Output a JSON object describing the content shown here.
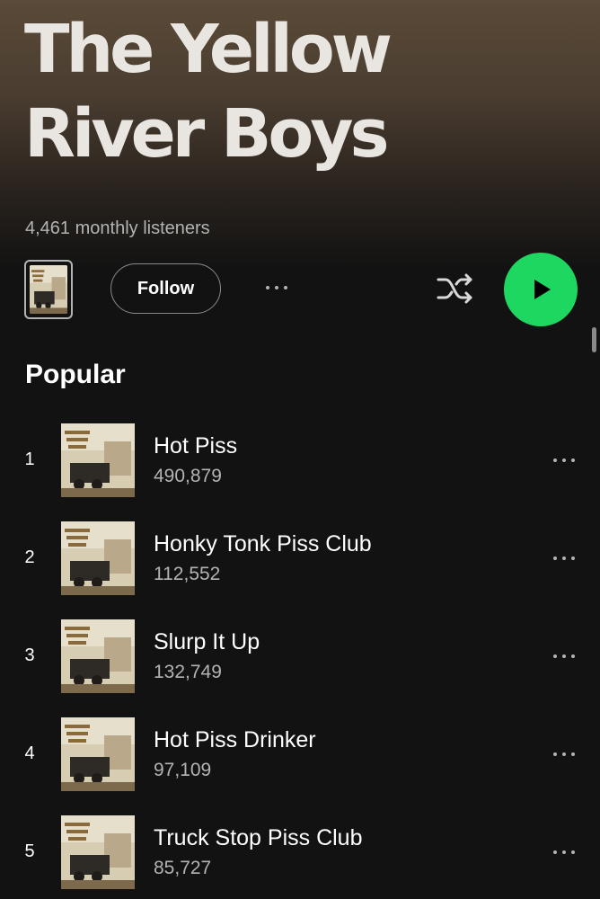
{
  "artist": {
    "name_line1": "The Yellow",
    "name_line2": "River Boys",
    "monthly_listeners": "4,461 monthly listeners"
  },
  "controls": {
    "follow_label": "Follow",
    "more_icon": "more-horizontal-icon",
    "shuffle_icon": "shuffle-icon",
    "play_icon": "play-icon"
  },
  "popular": {
    "title": "Popular",
    "tracks": [
      {
        "rank": "1",
        "title": "Hot Piss",
        "plays": "490,879"
      },
      {
        "rank": "2",
        "title": "Honky Tonk Piss Club",
        "plays": "112,552"
      },
      {
        "rank": "3",
        "title": "Slurp It Up",
        "plays": "132,749"
      },
      {
        "rank": "4",
        "title": "Hot Piss Drinker",
        "plays": "97,109"
      },
      {
        "rank": "5",
        "title": "Truck Stop Piss Club",
        "plays": "85,727"
      }
    ]
  },
  "colors": {
    "accent": "#1ed760",
    "background": "#121212",
    "secondary_text": "#b3b3b3"
  }
}
